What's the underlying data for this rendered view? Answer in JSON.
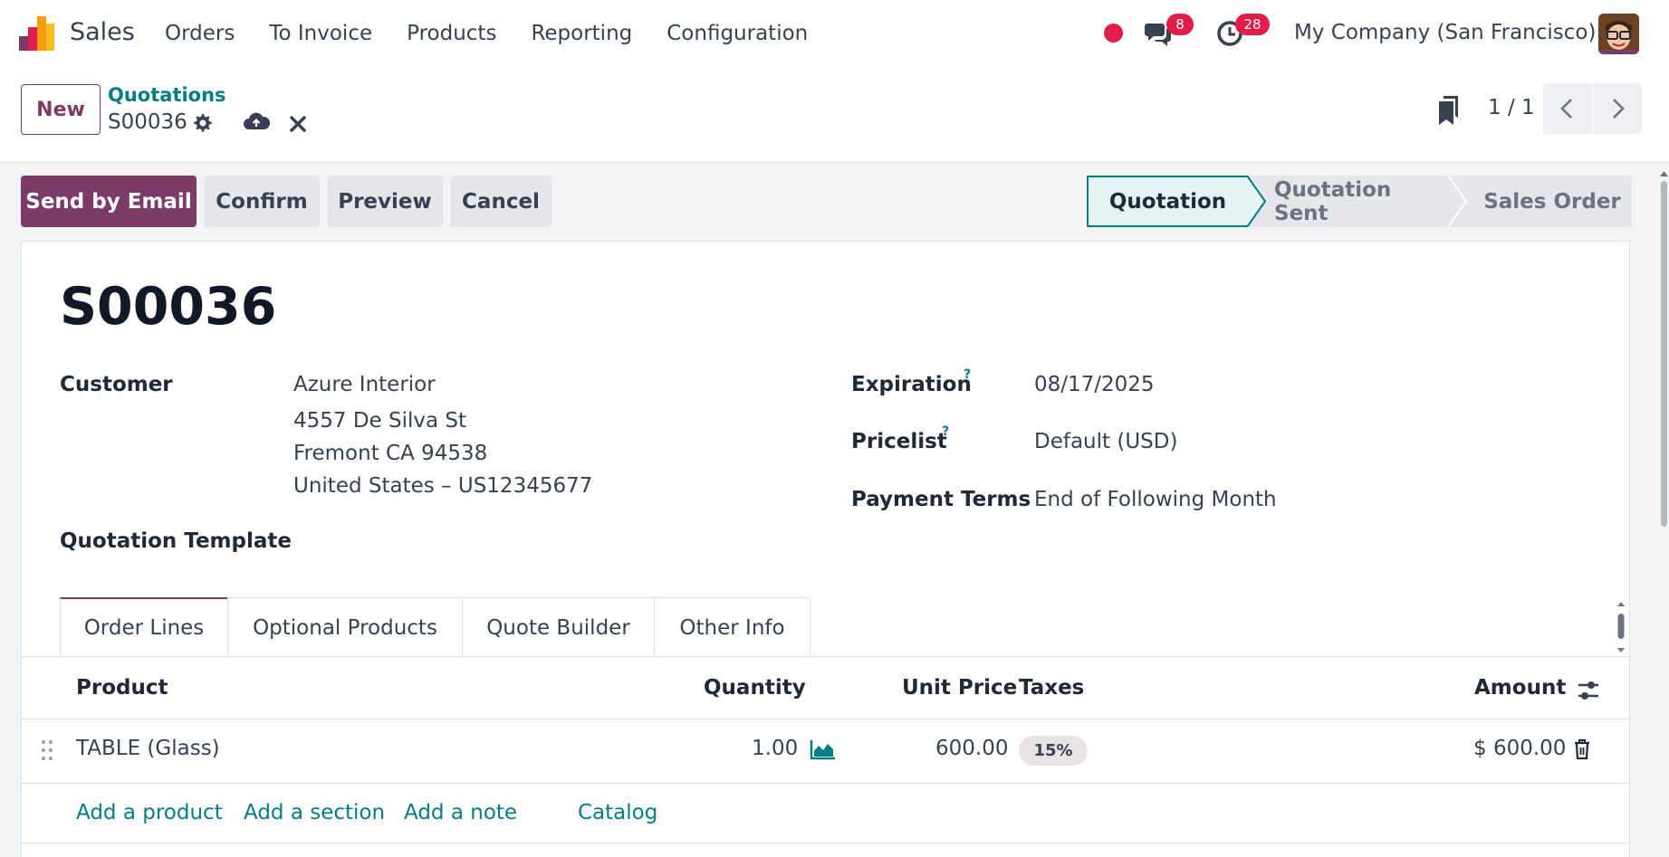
{
  "navbar": {
    "app_name": "Sales",
    "menu": [
      "Orders",
      "To Invoice",
      "Products",
      "Reporting",
      "Configuration"
    ],
    "messages_count": "8",
    "activities_count": "28",
    "company": "My Company (San Francisco)"
  },
  "control_panel": {
    "new_label": "New",
    "breadcrumb_parent": "Quotations",
    "breadcrumb_current": "S00036",
    "pager": "1 / 1"
  },
  "actions": {
    "send_email": "Send by Email",
    "confirm": "Confirm",
    "preview": "Preview",
    "cancel": "Cancel"
  },
  "status": {
    "stages": [
      "Quotation",
      "Quotation Sent",
      "Sales Order"
    ],
    "active": "Quotation"
  },
  "form": {
    "name": "S00036",
    "customer_label": "Customer",
    "customer_name": "Azure Interior",
    "customer_street": "4557 De Silva St",
    "customer_city": "Fremont CA 94538",
    "customer_country": "United States – US12345677",
    "template_label": "Quotation Template",
    "expiration_label": "Expiration",
    "expiration_value": "08/17/2025",
    "pricelist_label": "Pricelist",
    "pricelist_value": "Default (USD)",
    "payment_terms_label": "Payment Terms",
    "payment_terms_value": "End of Following Month",
    "help_mark": "?"
  },
  "tabs": [
    "Order Lines",
    "Optional Products",
    "Quote Builder",
    "Other Info"
  ],
  "order_lines": {
    "columns": {
      "product": "Product",
      "quantity": "Quantity",
      "unit_price": "Unit Price",
      "taxes": "Taxes",
      "amount": "Amount"
    },
    "rows": [
      {
        "product": "TABLE (Glass)",
        "quantity": "1.00",
        "unit_price": "600.00",
        "taxes": "15%",
        "amount": "$ 600.00"
      }
    ],
    "add_links": {
      "product": "Add a product",
      "section": "Add a section",
      "note": "Add a note",
      "catalog": "Catalog"
    }
  },
  "colors": {
    "brand": "#7c3a66",
    "link": "#017e84",
    "badge": "#e11d48"
  }
}
